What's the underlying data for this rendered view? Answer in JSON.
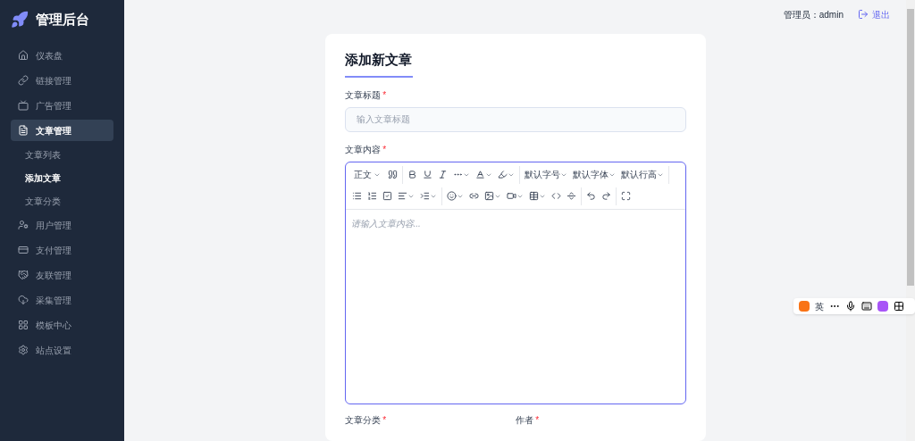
{
  "brand": {
    "title": "管理后台"
  },
  "sidebar": {
    "items": [
      {
        "label": "仪表盘",
        "selected": false
      },
      {
        "label": "链接管理",
        "selected": false
      },
      {
        "label": "广告管理",
        "selected": false
      },
      {
        "label": "文章管理",
        "selected": true,
        "children": [
          {
            "label": "文章列表",
            "selected": false
          },
          {
            "label": "添加文章",
            "selected": true
          },
          {
            "label": "文章分类",
            "selected": false
          }
        ]
      },
      {
        "label": "用户管理",
        "selected": false
      },
      {
        "label": "支付管理",
        "selected": false
      },
      {
        "label": "友联管理",
        "selected": false
      },
      {
        "label": "采集管理",
        "selected": false
      },
      {
        "label": "模板中心",
        "selected": false
      },
      {
        "label": "站点设置",
        "selected": false
      }
    ]
  },
  "header": {
    "user": "管理员：admin",
    "logout": "退出"
  },
  "form": {
    "title": "添加新文章",
    "title_field": {
      "label": "文章标题",
      "required": "*",
      "placeholder": "输入文章标题"
    },
    "content_field": {
      "label": "文章内容",
      "required": "*",
      "format_button": "正文",
      "font_buttons": [
        "默认字号",
        "默认字体",
        "默认行高"
      ],
      "placeholder": "请输入文章内容..."
    },
    "bottom_fields": [
      {
        "label": "文章分类",
        "required": "*"
      },
      {
        "label": "作者",
        "required": "*"
      }
    ]
  },
  "ime_toolbar": {
    "label": "英"
  }
}
